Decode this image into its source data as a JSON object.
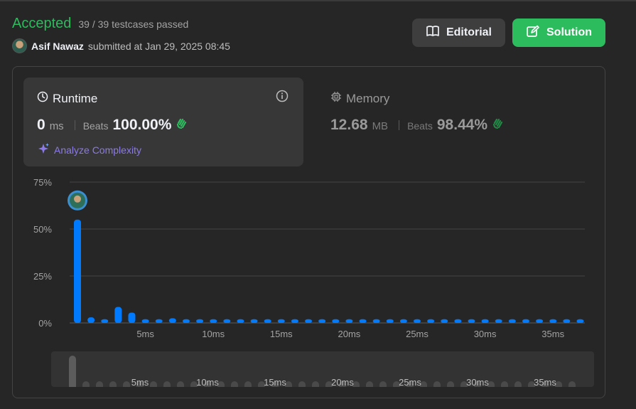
{
  "header": {
    "status": "Accepted",
    "testcases": "39 / 39 testcases passed",
    "submitter_name": "Asif Nawaz",
    "submitted_text": "submitted at Jan 29, 2025 08:45",
    "editorial_label": "Editorial",
    "solution_label": "Solution"
  },
  "runtime": {
    "title": "Runtime",
    "value": "0",
    "unit": "ms",
    "beats_label": "Beats",
    "beats_value": "100.00%",
    "analyze_label": "Analyze Complexity"
  },
  "memory": {
    "title": "Memory",
    "value": "12.68",
    "unit": "MB",
    "beats_label": "Beats",
    "beats_value": "98.44%"
  },
  "colors": {
    "accent": "#2cbb5d",
    "bar": "#007aff",
    "ai": "#8c7ae6",
    "muted": "#a3a3a3"
  },
  "icons": {
    "editorial": "book-icon",
    "solution": "edit-icon",
    "runtime": "clock-icon",
    "memory": "chip-icon",
    "info": "info-icon",
    "beats": "clap-icon",
    "analyze": "sparkle-icon"
  },
  "chart_data": {
    "type": "bar",
    "y_ticks": [
      "75%",
      "50%",
      "25%",
      "0%"
    ],
    "ylim": [
      0,
      75
    ],
    "x_ticks": [
      "5ms",
      "10ms",
      "15ms",
      "20ms",
      "25ms",
      "30ms",
      "35ms"
    ],
    "x": [
      1,
      2,
      3,
      4,
      5,
      6,
      7,
      8,
      9,
      10,
      11,
      12,
      13,
      14,
      15,
      16,
      17,
      18,
      19,
      20,
      21,
      22,
      23,
      24,
      25,
      26,
      27,
      28,
      29,
      30,
      31,
      32,
      33,
      34,
      35,
      36,
      37,
      38
    ],
    "values": [
      55,
      3,
      2,
      8.5,
      5.5,
      2,
      2,
      2.5,
      2,
      2,
      2,
      2,
      2,
      2,
      2,
      2,
      2,
      2,
      2,
      2,
      2,
      2,
      2,
      2,
      2,
      2,
      2,
      2,
      2,
      2,
      2,
      2,
      2,
      2,
      2,
      2,
      2,
      2
    ],
    "highlight_index": 0
  }
}
